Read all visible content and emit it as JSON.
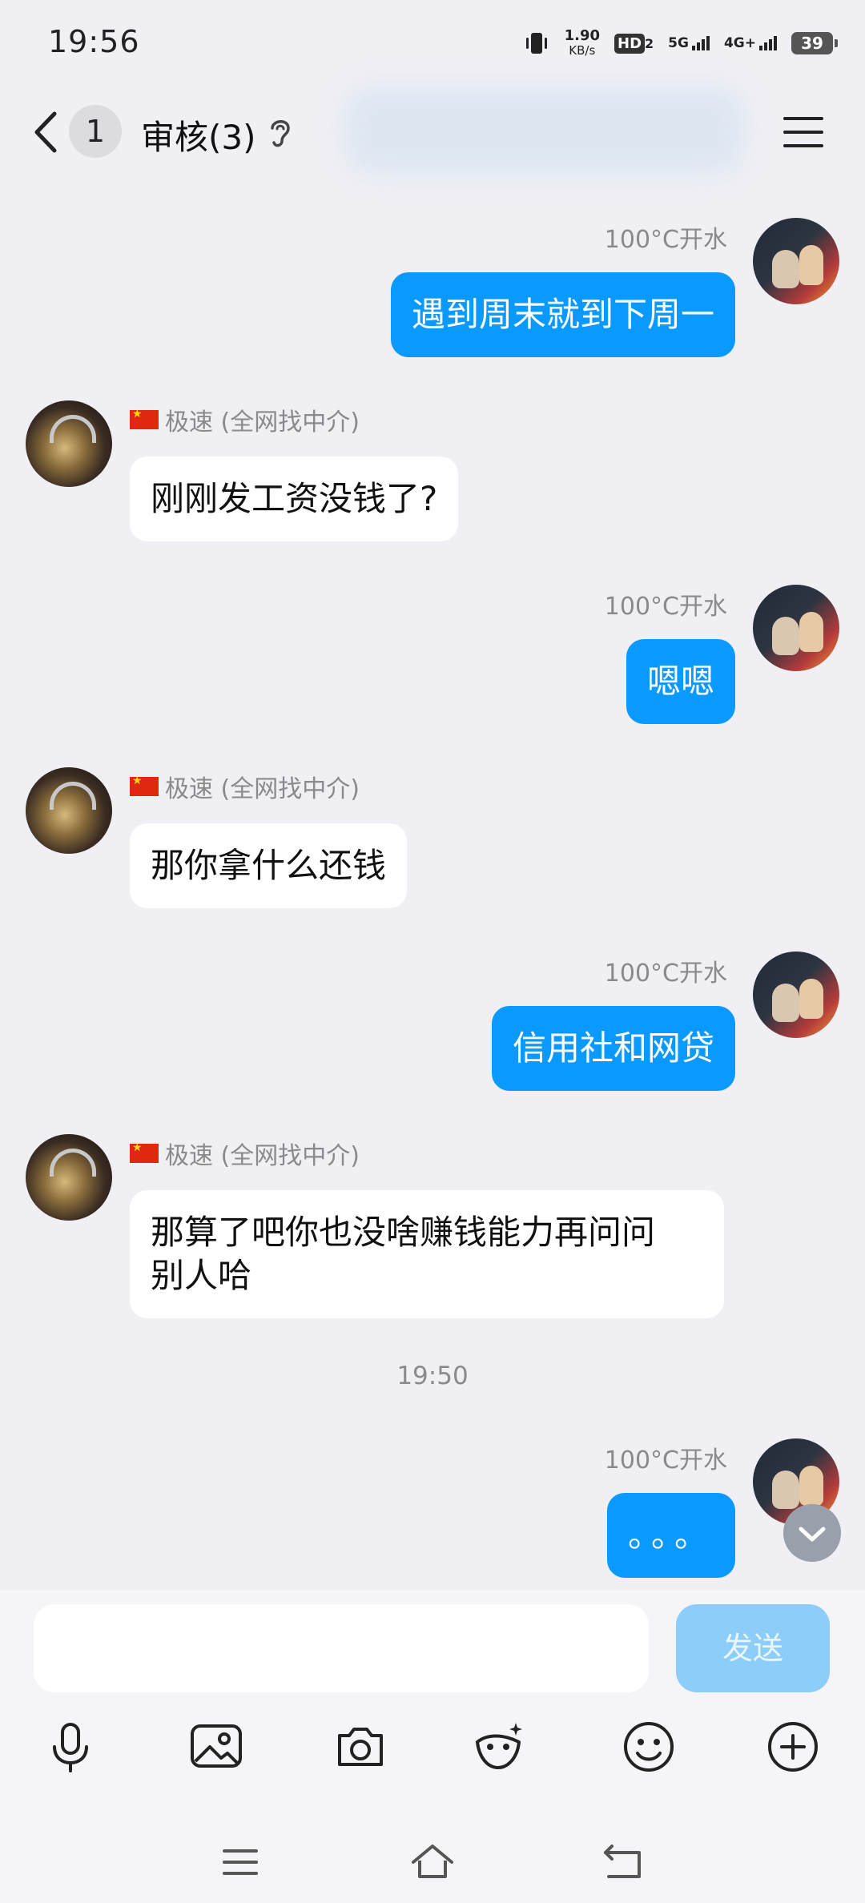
{
  "status": {
    "time": "19:56",
    "speed_value": "1.90",
    "speed_unit": "KB/s",
    "hd_label": "HD",
    "hd_sub": "2",
    "net1": "5G",
    "net2": "4G+",
    "battery": "39"
  },
  "header": {
    "unread_count": "1",
    "title": "审核(3)"
  },
  "messages": [
    {
      "side": "me",
      "sender": "100°C开水",
      "text": "遇到周末就到下周一"
    },
    {
      "side": "other",
      "sender": "极速 (全网找中介)",
      "text": "刚刚发工资没钱了?"
    },
    {
      "side": "me",
      "sender": "100°C开水",
      "text": "嗯嗯"
    },
    {
      "side": "other",
      "sender": "极速 (全网找中介)",
      "text": "那你拿什么还钱"
    },
    {
      "side": "me",
      "sender": "100°C开水",
      "text": "信用社和网贷"
    },
    {
      "side": "other",
      "sender": "极速 (全网找中介)",
      "text_line1": "那算了吧你也没啥赚钱能力再问问",
      "text_line2": "别人哈"
    },
    {
      "side": "me",
      "sender": "100°C开水",
      "text": "。。。"
    }
  ],
  "time_separator": "19:50",
  "composer": {
    "placeholder": "",
    "send_label": "发送"
  },
  "colors": {
    "accent": "#0a99ff",
    "send_disabled": "#8ccdfa",
    "background": "#efeff4"
  }
}
